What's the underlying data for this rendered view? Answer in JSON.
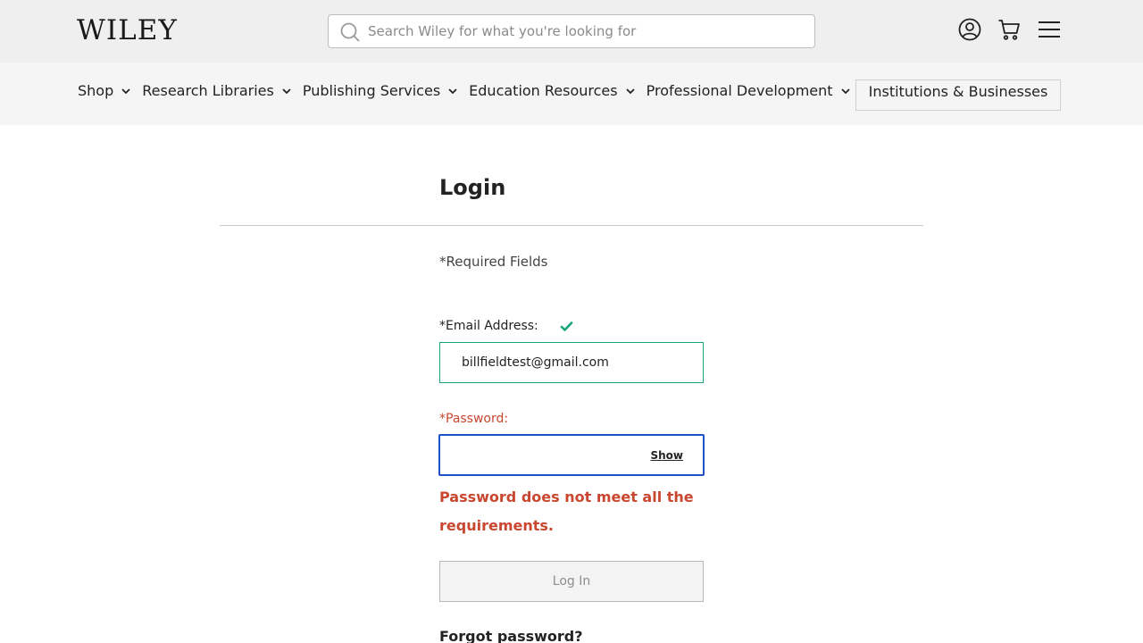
{
  "header": {
    "logo_text": "WILEY",
    "search_placeholder": "Search Wiley for what you're looking for",
    "icons": [
      "search-icon",
      "account-icon",
      "cart-icon",
      "menu-icon"
    ]
  },
  "nav": {
    "items": [
      {
        "label": "Shop"
      },
      {
        "label": "Research Libraries"
      },
      {
        "label": "Publishing Services"
      },
      {
        "label": "Education Resources"
      },
      {
        "label": "Professional Development"
      }
    ],
    "institutions_button": "Institutions & Businesses"
  },
  "login": {
    "title": "Login",
    "required_note": "*Required Fields",
    "email_label": "*Email Address:",
    "email_value": "billfieldtest@gmail.com",
    "password_label": "*Password:",
    "password_value": "",
    "show_label": "Show",
    "error_message": "Password does not meet all the requirements.",
    "login_button": "Log In",
    "forgot_link": "Forgot password?"
  },
  "colors": {
    "error": "#c9462f",
    "valid": "#16a57a",
    "focus": "#1d53c9",
    "header_bg": "#efefef",
    "nav_bg": "#f5f5f5"
  }
}
